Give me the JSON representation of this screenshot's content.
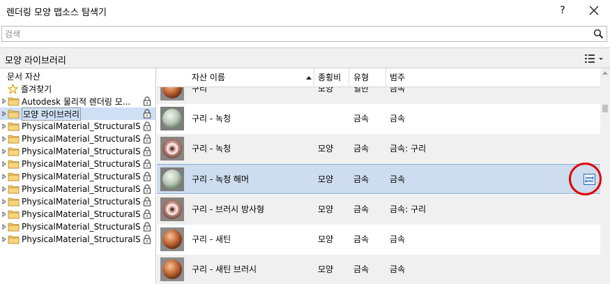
{
  "window": {
    "title": "렌더링 모양 맵소스 탐색기",
    "help_label": "?"
  },
  "search": {
    "placeholder": "검색",
    "value": ""
  },
  "library_header": {
    "title": "모양 라이브러리"
  },
  "tree": {
    "document_assets": "문서 자산",
    "favorites": "즐겨찾기",
    "items": [
      {
        "label": "Autodesk 물리적 렌더링 모...",
        "selected": false
      },
      {
        "label": "모양 라이브러리",
        "selected": true
      },
      {
        "label": "PhysicalMaterial_StructuralSteel",
        "selected": false
      },
      {
        "label": "PhysicalMaterial_StructuralSteel",
        "selected": false
      },
      {
        "label": "PhysicalMaterial_StructuralSteel",
        "selected": false
      },
      {
        "label": "PhysicalMaterial_StructuralSteel",
        "selected": false
      },
      {
        "label": "PhysicalMaterial_StructuralSteel",
        "selected": false
      },
      {
        "label": "PhysicalMaterial_StructuralSteel",
        "selected": false
      },
      {
        "label": "PhysicalMaterial_StructuralSteel",
        "selected": false
      },
      {
        "label": "PhysicalMaterial_StructuralSteel",
        "selected": false
      },
      {
        "label": "PhysicalMaterial_StructuralSteel",
        "selected": false
      },
      {
        "label": "PhysicalMaterial_StructuralSteel",
        "selected": false
      }
    ]
  },
  "grid": {
    "columns": [
      "자산 이름",
      "종횡비",
      "유형",
      "범주"
    ],
    "rows": [
      {
        "name": "구리",
        "aspect": "모양",
        "type": "일반",
        "category": "금속",
        "thumb": "copper"
      },
      {
        "name": "구리 - 녹청",
        "aspect": "",
        "type": "금속",
        "category": "금속",
        "thumb": "patina"
      },
      {
        "name": "구리 - 녹청",
        "aspect": "모양",
        "type": "금속",
        "category": "금속: 구리",
        "thumb": "swirl"
      },
      {
        "name": "구리 - 녹청 해머",
        "aspect": "모양",
        "type": "금속",
        "category": "금속",
        "thumb": "patina"
      },
      {
        "name": "구리 - 브러시 방사형",
        "aspect": "모양",
        "type": "금속",
        "category": "금속: 구리",
        "thumb": "swirl"
      },
      {
        "name": "구리 - 새틴",
        "aspect": "모양",
        "type": "금속",
        "category": "금속",
        "thumb": "copper"
      },
      {
        "name": "구리 - 새틴 브러시",
        "aspect": "모양",
        "type": "금속",
        "category": "금속",
        "thumb": "copper"
      }
    ]
  },
  "colors": {
    "selection": "#cddcee",
    "accent": "#2f6db5",
    "highlight_circle": "#e00000"
  },
  "icons": [
    "close-icon",
    "search-icon",
    "list-view-icon",
    "star-icon",
    "folder-icon",
    "lock-icon",
    "swap-icon"
  ]
}
